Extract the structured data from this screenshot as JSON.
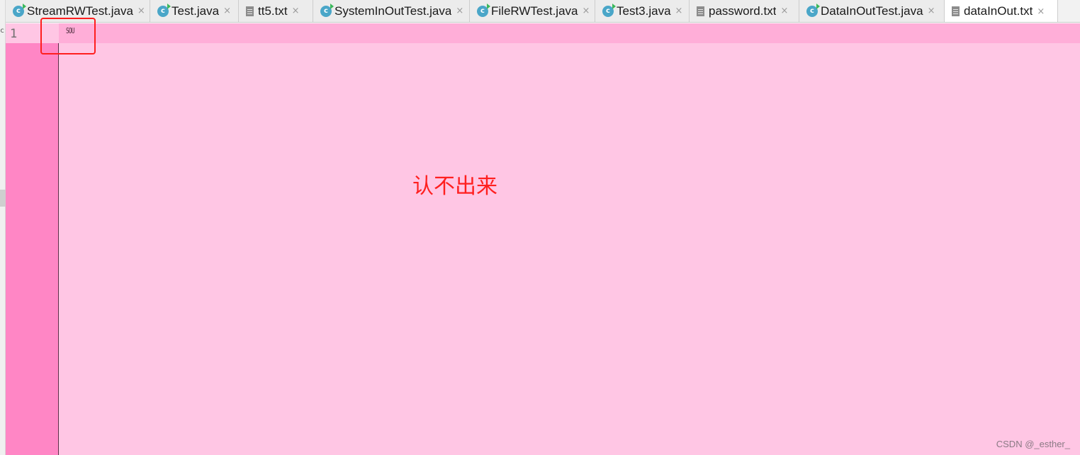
{
  "tabs": [
    {
      "label": "StreamRWTest.java",
      "icon": "java-class-icon",
      "close": "×"
    },
    {
      "label": "Test.java",
      "icon": "java-class-icon",
      "close": "×"
    },
    {
      "label": "tt5.txt",
      "icon": "text-file-icon",
      "close": "×"
    },
    {
      "label": "SystemInOutTest.java",
      "icon": "java-class-icon",
      "close": "×"
    },
    {
      "label": "FileRWTest.java",
      "icon": "java-class-icon",
      "close": "×"
    },
    {
      "label": "Test3.java",
      "icon": "java-class-icon",
      "close": "×"
    },
    {
      "label": "password.txt",
      "icon": "text-file-icon",
      "close": "×"
    },
    {
      "label": "DataInOutTest.java",
      "icon": "java-class-icon",
      "close": "×"
    },
    {
      "label": "dataInOut.txt",
      "icon": "text-file-icon",
      "close": "×",
      "active": true
    }
  ],
  "side_fragment": "c",
  "java_icon_letter": "c",
  "editor": {
    "line_number": "1",
    "content": "SOU"
  },
  "annotation": "认不出来",
  "watermark": "CSDN @_esther_",
  "colors": {
    "editor_bg": "#ffc6e4",
    "gutter_bg": "#ff86c5",
    "current_line": "#ffaed8",
    "annotation": "#ff1f1f"
  }
}
